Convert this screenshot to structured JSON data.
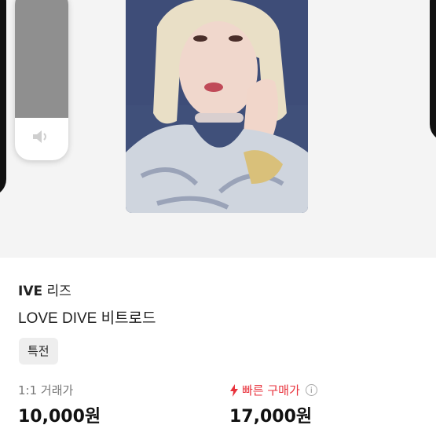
{
  "product": {
    "brand": "IVE",
    "member": "리즈",
    "title": "LOVE DIVE 비트로드",
    "tag": "특전"
  },
  "pricing": {
    "one_to_one_label": "1:1 거래가",
    "one_to_one_price": "10,000원",
    "fast_buy_label": "빠른 구매가",
    "fast_buy_price": "17,000원",
    "info_glyph": "i"
  },
  "volume_overlay": {
    "level": 0.75,
    "icon": "speaker-icon"
  },
  "colors": {
    "accent_red": "#e8323c",
    "tag_bg": "#eeeeee",
    "image_bg": "#f4f4f4"
  }
}
